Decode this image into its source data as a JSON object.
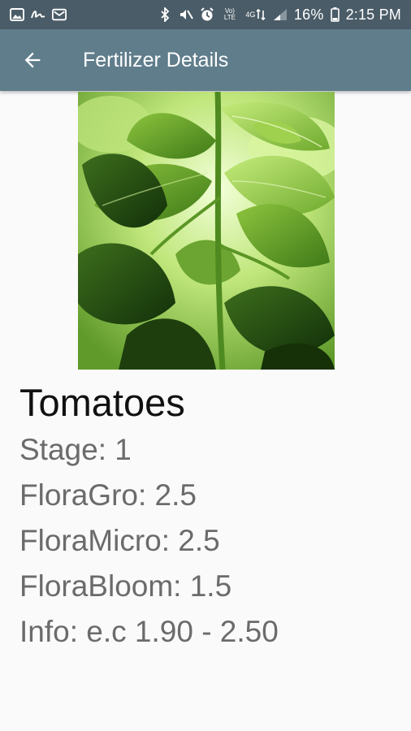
{
  "status_bar": {
    "battery": "16%",
    "time": "2:15 PM",
    "volte": "Vo) LTE",
    "network": "4G"
  },
  "app_bar": {
    "title": "Fertilizer Details",
    "back_icon": "arrow-back-icon"
  },
  "plant": {
    "image_icon": "basil-plant-photo",
    "name": "Tomatoes",
    "stage": "Stage: 1",
    "flora_gro": "FloraGro: 2.5",
    "flora_micro": "FloraMicro: 2.5",
    "flora_bloom": "FloraBloom: 1.5",
    "info": "Info: e.c 1.90 - 2.50"
  },
  "colors": {
    "status_bar": "#4a5c67",
    "app_bar": "#607d8b",
    "background": "#fafafa",
    "title_text": "#111111",
    "detail_text": "#6b6b6b"
  }
}
